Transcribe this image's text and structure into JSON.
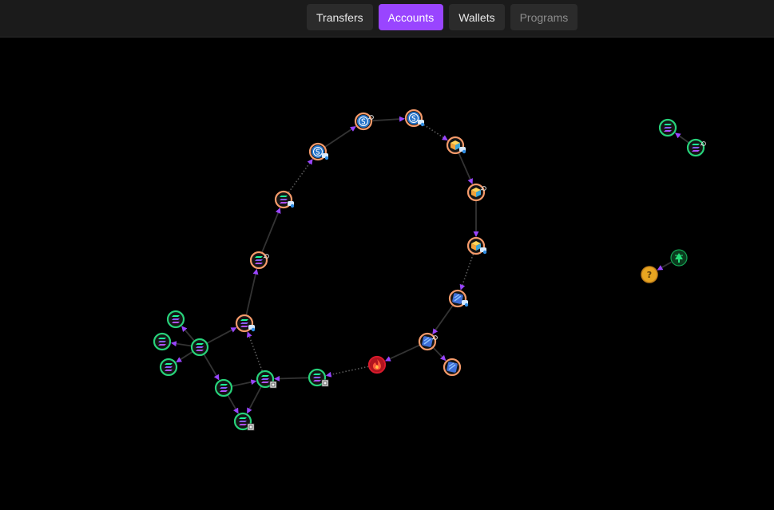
{
  "nav": {
    "tabs": [
      {
        "label": "Transfers",
        "name": "tab-transfers",
        "state": "normal"
      },
      {
        "label": "Accounts",
        "name": "tab-accounts",
        "state": "active"
      },
      {
        "label": "Wallets",
        "name": "tab-wallets",
        "state": "normal"
      },
      {
        "label": "Programs",
        "name": "tab-programs",
        "state": "muted"
      }
    ]
  },
  "colors": {
    "accent": "#9945ff",
    "edge_solid": "#333333",
    "edge_dotted": "#5a5a5a",
    "arrow": "#9945ff",
    "ring_owner_wallet": "#27d27a",
    "ring_token_account": "#f59a6a",
    "ring_burn": "#d81a2c"
  },
  "graph": {
    "nodes": [
      {
        "id": "usdc-a",
        "kind": "token-account",
        "icon": "usdc-icon",
        "badge": "link-badge"
      },
      {
        "id": "usdc-b",
        "kind": "token-account",
        "icon": "usdc-icon",
        "badge": "chat-badge"
      },
      {
        "id": "usdc-c",
        "kind": "token-account",
        "icon": "usdc-icon",
        "badge": "chat-badge"
      },
      {
        "id": "sol-tok-a",
        "kind": "token-account",
        "icon": "solana-icon",
        "badge": "chat-badge"
      },
      {
        "id": "sol-tok-b",
        "kind": "token-account",
        "icon": "solana-icon",
        "badge": "link-badge"
      },
      {
        "id": "sol-tok-c",
        "kind": "token-account",
        "icon": "solana-icon",
        "badge": "chat-badge"
      },
      {
        "id": "cube-a",
        "kind": "token-account",
        "icon": "cube-icon",
        "badge": "chat-badge"
      },
      {
        "id": "cube-b",
        "kind": "token-account",
        "icon": "cube-icon",
        "badge": "link-badge"
      },
      {
        "id": "cube-c",
        "kind": "token-account",
        "icon": "cube-icon",
        "badge": "chat-badge"
      },
      {
        "id": "blue-a",
        "kind": "token-account",
        "icon": "blue-token-icon",
        "badge": "chat-badge"
      },
      {
        "id": "blue-b",
        "kind": "token-account",
        "icon": "blue-token-icon",
        "badge": "link-badge"
      },
      {
        "id": "blue-c",
        "kind": "token-account",
        "icon": "blue-token-icon",
        "badge": ""
      },
      {
        "id": "burn",
        "kind": "burn",
        "icon": "flame-icon",
        "badge": ""
      },
      {
        "id": "wal-a",
        "kind": "wallet",
        "icon": "solana-icon",
        "badge": "program-badge"
      },
      {
        "id": "wal-b",
        "kind": "wallet",
        "icon": "solana-icon",
        "badge": "program-badge"
      },
      {
        "id": "wal-c",
        "kind": "wallet",
        "icon": "solana-icon",
        "badge": ""
      },
      {
        "id": "wal-d",
        "kind": "wallet",
        "icon": "solana-icon",
        "badge": ""
      },
      {
        "id": "wal-e",
        "kind": "wallet",
        "icon": "solana-icon",
        "badge": ""
      },
      {
        "id": "wal-f",
        "kind": "wallet",
        "icon": "solana-icon",
        "badge": ""
      },
      {
        "id": "wal-g",
        "kind": "wallet",
        "icon": "solana-icon",
        "badge": ""
      },
      {
        "id": "wal-h",
        "kind": "wallet",
        "icon": "solana-icon",
        "badge": "program-badge"
      },
      {
        "id": "wal-i",
        "kind": "wallet",
        "icon": "solana-icon",
        "badge": ""
      },
      {
        "id": "wal-j",
        "kind": "wallet",
        "icon": "solana-icon",
        "badge": "link-badge"
      },
      {
        "id": "unknown",
        "kind": "unknown-token",
        "icon": "question-icon",
        "badge": ""
      },
      {
        "id": "tree",
        "kind": "program",
        "icon": "tree-icon",
        "badge": ""
      }
    ],
    "edges": [
      {
        "from": "sol-tok-c",
        "to": "sol-tok-b",
        "style": "solid"
      },
      {
        "from": "sol-tok-b",
        "to": "sol-tok-a",
        "style": "solid"
      },
      {
        "from": "sol-tok-a",
        "to": "usdc-c",
        "style": "dotted"
      },
      {
        "from": "usdc-c",
        "to": "usdc-a",
        "style": "solid"
      },
      {
        "from": "usdc-a",
        "to": "usdc-b",
        "style": "solid"
      },
      {
        "from": "usdc-b",
        "to": "cube-a",
        "style": "dotted"
      },
      {
        "from": "cube-a",
        "to": "cube-b",
        "style": "solid"
      },
      {
        "from": "cube-b",
        "to": "cube-c",
        "style": "solid"
      },
      {
        "from": "cube-c",
        "to": "blue-a",
        "style": "dotted"
      },
      {
        "from": "blue-a",
        "to": "blue-b",
        "style": "solid"
      },
      {
        "from": "blue-b",
        "to": "blue-c",
        "style": "solid"
      },
      {
        "from": "blue-b",
        "to": "burn",
        "style": "solid"
      },
      {
        "from": "burn",
        "to": "wal-b",
        "style": "dotted"
      },
      {
        "from": "wal-b",
        "to": "wal-a",
        "style": "solid"
      },
      {
        "from": "wal-a",
        "to": "sol-tok-c",
        "style": "dotted"
      },
      {
        "from": "wal-g",
        "to": "sol-tok-c",
        "style": "solid"
      },
      {
        "from": "wal-g",
        "to": "wal-c",
        "style": "solid"
      },
      {
        "from": "wal-g",
        "to": "wal-d",
        "style": "solid"
      },
      {
        "from": "wal-g",
        "to": "wal-e",
        "style": "solid"
      },
      {
        "from": "wal-g",
        "to": "wal-f",
        "style": "solid"
      },
      {
        "from": "wal-f",
        "to": "wal-a",
        "style": "solid"
      },
      {
        "from": "wal-f",
        "to": "wal-h",
        "style": "solid"
      },
      {
        "from": "wal-a",
        "to": "wal-h",
        "style": "solid"
      },
      {
        "from": "wal-j",
        "to": "wal-i",
        "style": "solid"
      },
      {
        "from": "tree",
        "to": "unknown",
        "style": "solid"
      }
    ]
  }
}
